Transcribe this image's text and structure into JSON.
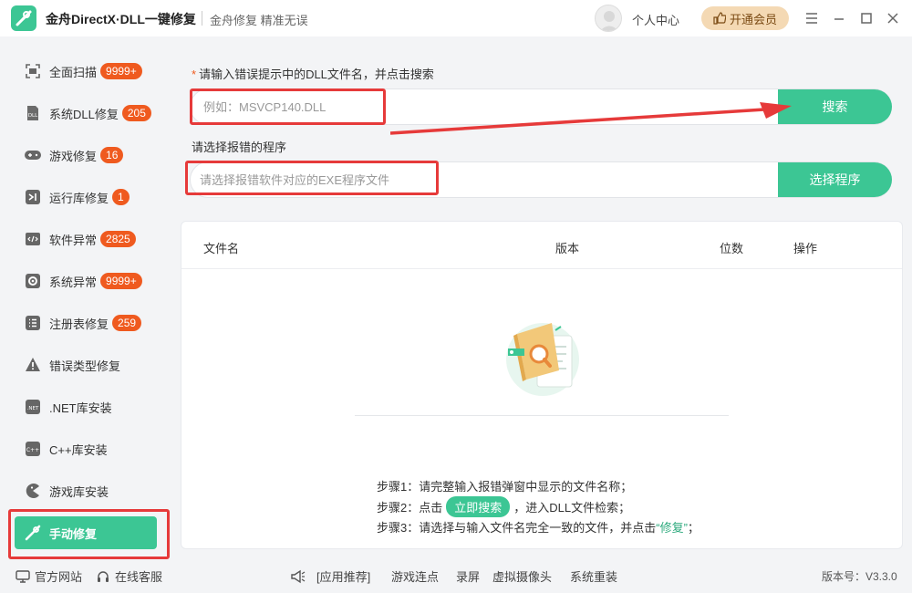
{
  "app": {
    "title": "金舟DirectX·DLL一键修复",
    "subtitle": "金舟修复 精准无误",
    "user_center": "个人中心",
    "vip_button": "开通会员",
    "accent_color": "#3cc694",
    "badge_color": "#ef5a1f",
    "highlight_color": "#e63a3a"
  },
  "sidebar": {
    "items": [
      {
        "label": "全面扫描",
        "badge": "9999+",
        "icon": "scan-icon"
      },
      {
        "label": "系统DLL修复",
        "badge": "205",
        "icon": "dll-file-icon"
      },
      {
        "label": "游戏修复",
        "badge": "16",
        "icon": "gamepad-icon"
      },
      {
        "label": "运行库修复",
        "badge": "1",
        "icon": "visual-studio-icon"
      },
      {
        "label": "软件异常",
        "badge": "2825",
        "icon": "code-window-icon"
      },
      {
        "label": "系统异常",
        "badge": "9999+",
        "icon": "gear-icon"
      },
      {
        "label": "注册表修复",
        "badge": "259",
        "icon": "list-icon"
      },
      {
        "label": "错误类型修复",
        "badge": "",
        "icon": "warning-icon"
      },
      {
        "label": ".NET库安装",
        "badge": "",
        "icon": "dotnet-icon"
      },
      {
        "label": "C++库安装",
        "badge": "",
        "icon": "cpp-icon"
      },
      {
        "label": "游戏库安装",
        "badge": "",
        "icon": "pacman-icon"
      },
      {
        "label": "手动修复",
        "badge": "",
        "icon": "tools-icon",
        "active": true
      }
    ]
  },
  "main": {
    "prompt_required_mark": "*",
    "prompt_dll": "请输入错误提示中的DLL文件名，并点击搜索",
    "dll_placeholder": "例如：MSVCP140.DLL",
    "search_button": "搜索",
    "prompt_exe": "请选择报错的程序",
    "exe_placeholder": "请选择报错软件对应的EXE程序文件",
    "select_button": "选择程序"
  },
  "results": {
    "columns": [
      "文件名",
      "版本",
      "位数",
      "操作"
    ],
    "step1": "步骤1：请完整输入报错弹窗中显示的文件名称；",
    "step2_prefix": "步骤2：点击",
    "step2_tag": "立即搜索",
    "step2_suffix": "，进入DLL文件检索；",
    "step3_prefix": "步骤3：请选择与输入文件名完全一致的文件，并点击",
    "step3_link": "“修复”",
    "step3_suffix": "；"
  },
  "footer": {
    "official_site": "官方网站",
    "online_service": "在线客服",
    "recommend": "[应用推荐]",
    "links": [
      "游戏连点",
      "录屏",
      "虚拟摄像头",
      "系统重装"
    ],
    "version": "版本号：V3.3.0"
  }
}
